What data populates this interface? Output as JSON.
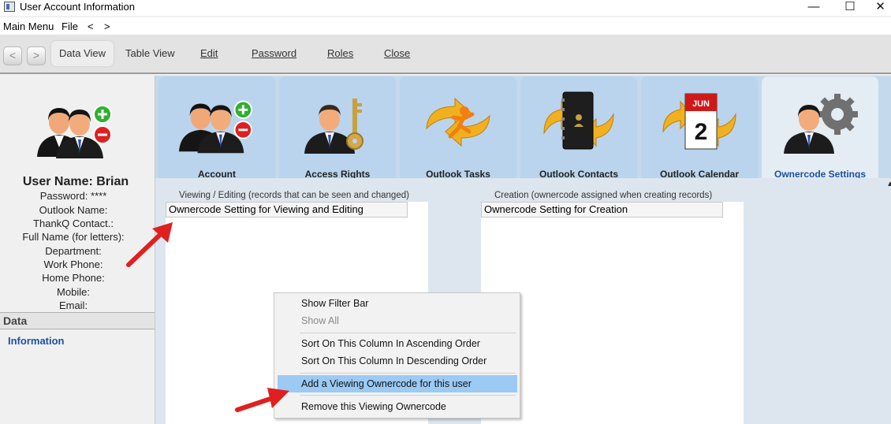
{
  "window": {
    "title": "User Account Information",
    "controls": {
      "minimize": "—",
      "maximize": "☐",
      "close": "✕"
    }
  },
  "menubar": {
    "items": [
      "Main Menu",
      "File",
      "<",
      ">"
    ]
  },
  "toolbar": {
    "back": "<",
    "forward": ">",
    "buttons": [
      "Data View",
      "Table View",
      "Edit",
      "Password",
      "Roles",
      "Close"
    ],
    "active": "Data View"
  },
  "sidebar": {
    "username": "User Name: Brian",
    "fields": [
      "Password: ****",
      "Outlook Name:",
      "ThankQ Contact.:",
      "Full Name (for letters):",
      "Department:",
      "Work Phone:",
      "Home Phone:",
      "Mobile:",
      "Email:"
    ],
    "section_title": "Data",
    "link": "Information"
  },
  "tabs": [
    {
      "label": "Account",
      "icon": "users-add-remove-icon"
    },
    {
      "label": "Access Rights",
      "icon": "user-key-icon"
    },
    {
      "label": "Outlook Tasks",
      "icon": "tasks-sync-icon"
    },
    {
      "label": "Outlook Contacts",
      "icon": "contacts-sync-icon"
    },
    {
      "label": "Outlook Calendar",
      "icon": "calendar-sync-icon"
    },
    {
      "label": "Ownercode Settings",
      "icon": "user-gear-icon"
    }
  ],
  "active_tab": "Ownercode Settings",
  "calendar_icon": {
    "month": "JUN",
    "day": "2"
  },
  "viewing": {
    "group_label": "Viewing / Editing (records that can be seen and changed)",
    "column_header": "Ownercode Setting for Viewing and Editing"
  },
  "creation": {
    "group_label": "Creation (ownercode assigned when creating records)",
    "column_header": "Ownercode Setting for Creation"
  },
  "context_menu": {
    "items": [
      {
        "label": "Show Filter Bar",
        "enabled": true
      },
      {
        "label": "Show All",
        "enabled": false
      },
      {
        "label": "Sort On This Column In Ascending Order",
        "enabled": true
      },
      {
        "label": "Sort On This Column In Descending Order",
        "enabled": true
      },
      {
        "label": "Add a Viewing Ownercode for this user",
        "enabled": true,
        "highlighted": true
      },
      {
        "label": "Remove this Viewing Ownercode",
        "enabled": true
      }
    ]
  },
  "colors": {
    "accent_blue": "#1b4f9e",
    "tab_bg": "#b9d4ec",
    "highlight": "#9bcaf4",
    "annotation_arrow": "#e02020"
  }
}
